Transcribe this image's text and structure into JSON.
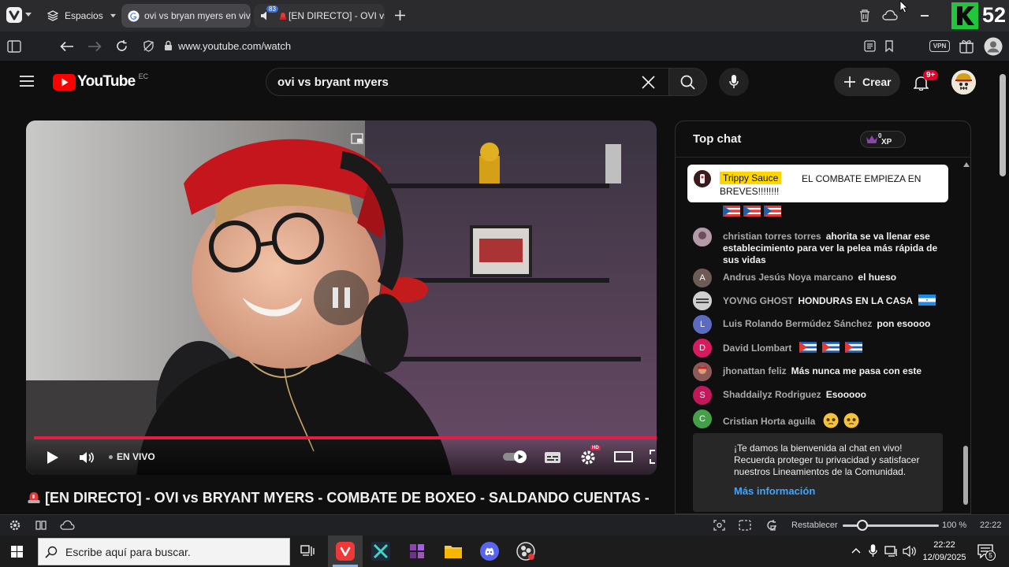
{
  "browser": {
    "tabs": [
      {
        "label": "Espacios"
      },
      {
        "label": "ovi vs bryan myers en vivo"
      },
      {
        "label": "[EN DIRECTO] - OVI vs B",
        "audio_badge": "83"
      }
    ],
    "url": "www.youtube.com/watch",
    "vpn_label": "VPN",
    "overlay_number": "52"
  },
  "youtube": {
    "logo_text": "YouTube",
    "country_code": "EC",
    "search_value": "ovi vs bryant myers",
    "create_label": "Crear",
    "notifications_badge": "9+"
  },
  "player": {
    "live_label": "EN VIVO",
    "hd_badge": "HD",
    "progress_fraction": 1.0
  },
  "video": {
    "title": "[EN DIRECTO] - OVI vs BRYANT MYERS - COMBATE DE BOXEO - SALDANDO CUENTAS -"
  },
  "chat": {
    "title": "Top chat",
    "xp_badge": "XP",
    "xp_count": "0",
    "pinned": {
      "author": "Trippy Sauce",
      "text": "EL COMBATE EMPIEZA EN BREVES!!!!!!!!"
    },
    "messages": [
      {
        "author": "christian torres torres",
        "text": "ahorita se va llenar ese establecimiento para ver la pelea más rápida de sus vidas",
        "avatar": "",
        "avatar_color": "#8a6d7a"
      },
      {
        "author": "Andrus Jesús Noya marcano",
        "text": "el hueso",
        "avatar": "A",
        "avatar_color": "#6d5b57"
      },
      {
        "author": "YOVNG GHOST",
        "text": "HONDURAS EN LA CASA",
        "avatar": "",
        "avatar_color": "#9a9a9a"
      },
      {
        "author": "Luis Rolando Bermúdez Sánchez",
        "text": "pon esoooo",
        "avatar": "L",
        "avatar_color": "#5c6bc0"
      },
      {
        "author": "David Llombart",
        "text": "",
        "avatar": "D",
        "avatar_color": "#d81b60"
      },
      {
        "author": "jhonattan feliz",
        "text": "Más nunca me pasa con este",
        "avatar": "",
        "avatar_color": "#7a4b4b"
      },
      {
        "author": "Shaddailyz Rodriguez",
        "text": "Esooooo",
        "avatar": "S",
        "avatar_color": "#c2185b"
      },
      {
        "author": "Cristian Horta aguila",
        "text": "",
        "avatar": "C",
        "avatar_color": "#43a047"
      }
    ],
    "welcome_text": "¡Te damos la bienvenida al chat en vivo! Recuerda proteger tu privacidad y satisfacer nuestros Lineamientos de la Comunidad.",
    "welcome_link": "Más información"
  },
  "statusbar": {
    "reset_label": "Restablecer",
    "zoom": "100 %",
    "time": "22:22"
  },
  "taskbar": {
    "search_placeholder": "Escribe aquí para buscar.",
    "clock_time": "22:22",
    "clock_date": "12/09/2025",
    "notifications_count": "5"
  }
}
